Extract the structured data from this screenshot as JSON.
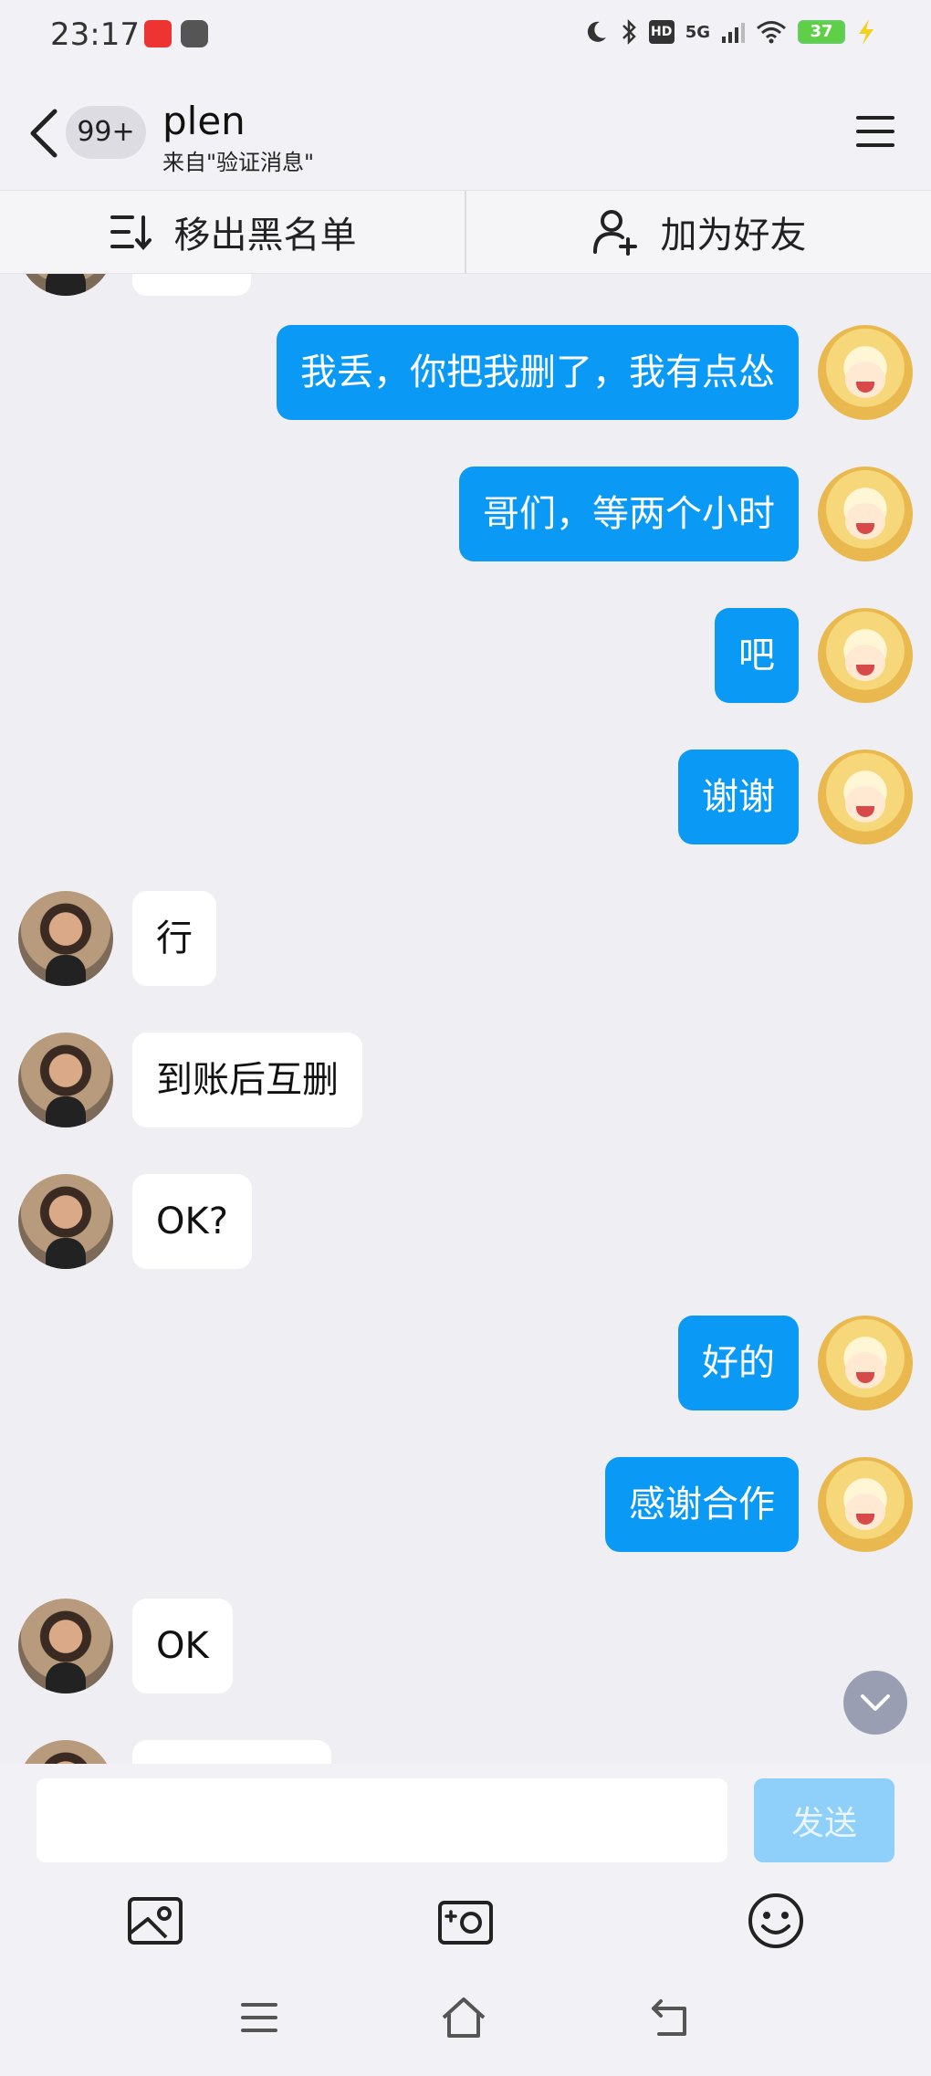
{
  "status_bar": {
    "time": "23:17",
    "network": "5G",
    "hd": "HD",
    "battery": "37"
  },
  "header": {
    "unread_count": "99+",
    "contact_name": "plen",
    "contact_source": "来自\"验证消息\"",
    "icons": {
      "back": "chevron-left-icon",
      "menu": "hamburger-menu-icon"
    }
  },
  "actions": {
    "remove_blacklist": "移出黑名单",
    "add_friend": "加为好友"
  },
  "messages": [
    {
      "side": "sent",
      "text": "我丢，你把我删了，我有点怂"
    },
    {
      "side": "sent",
      "text": "哥们，等两个小时"
    },
    {
      "side": "sent",
      "text": "吧"
    },
    {
      "side": "sent",
      "text": "谢谢"
    },
    {
      "side": "received",
      "text": "行"
    },
    {
      "side": "received",
      "text": "到账后互删"
    },
    {
      "side": "received",
      "text": "OK?"
    },
    {
      "side": "sent",
      "text": "好的"
    },
    {
      "side": "sent",
      "text": "感谢合作"
    },
    {
      "side": "received",
      "text": "OK"
    }
  ],
  "composer": {
    "placeholder": "",
    "send_label": "发送"
  },
  "colors": {
    "sent_bubble": "#0b99f6",
    "received_bubble": "#ffffff",
    "background": "#eeeef3",
    "send_disabled": "#8fd0fb"
  }
}
